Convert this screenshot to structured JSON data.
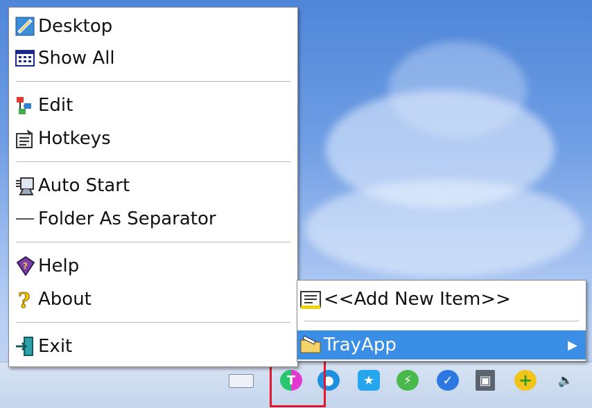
{
  "main_menu": {
    "items": [
      {
        "label": "Desktop",
        "icon": "desktop-icon"
      },
      {
        "label": "Show All",
        "icon": "show-all-icon"
      },
      {
        "label": "Edit",
        "icon": "edit-icon"
      },
      {
        "label": "Hotkeys",
        "icon": "hotkeys-icon"
      },
      {
        "label": "Auto Start",
        "icon": "auto-start-icon"
      },
      {
        "label": "Folder As Separator",
        "icon": "separator-line-icon"
      },
      {
        "label": "Help",
        "icon": "help-icon"
      },
      {
        "label": "About",
        "icon": "question-icon"
      },
      {
        "label": "Exit",
        "icon": "exit-icon"
      }
    ]
  },
  "sub_menu": {
    "items": [
      {
        "label": "<<Add New Item>>",
        "icon": "add-item-icon"
      },
      {
        "label": "TrayApp",
        "icon": "folder-icon",
        "selected": true
      }
    ],
    "arrow": "▶"
  },
  "taskbar": {
    "tray_icons": [
      "keyboard-icon",
      "trayapp-icon",
      "bird-icon",
      "star-icon",
      "shield-icon",
      "check-shield-icon",
      "network-icon",
      "plus-icon",
      "volume-icon"
    ]
  },
  "colors": {
    "selection": "#3a8ee6",
    "highlight_border": "#e2182a"
  }
}
